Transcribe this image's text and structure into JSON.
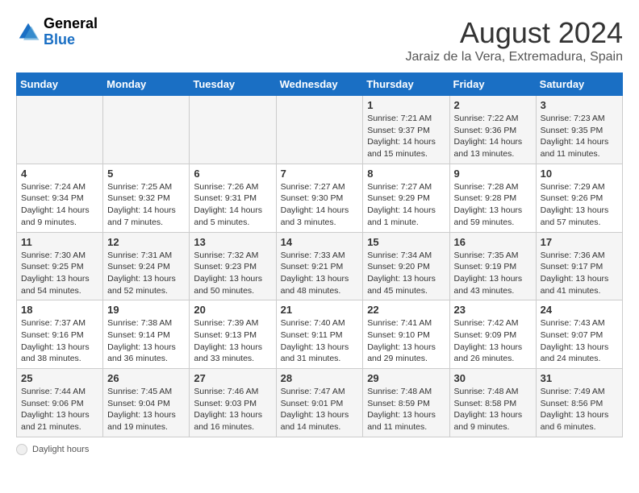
{
  "header": {
    "logo_line1": "General",
    "logo_line2": "Blue",
    "month_title": "August 2024",
    "subtitle": "Jaraiz de la Vera, Extremadura, Spain"
  },
  "weekdays": [
    "Sunday",
    "Monday",
    "Tuesday",
    "Wednesday",
    "Thursday",
    "Friday",
    "Saturday"
  ],
  "weeks": [
    [
      {
        "day": "",
        "info": ""
      },
      {
        "day": "",
        "info": ""
      },
      {
        "day": "",
        "info": ""
      },
      {
        "day": "",
        "info": ""
      },
      {
        "day": "1",
        "info": "Sunrise: 7:21 AM\nSunset: 9:37 PM\nDaylight: 14 hours and 15 minutes."
      },
      {
        "day": "2",
        "info": "Sunrise: 7:22 AM\nSunset: 9:36 PM\nDaylight: 14 hours and 13 minutes."
      },
      {
        "day": "3",
        "info": "Sunrise: 7:23 AM\nSunset: 9:35 PM\nDaylight: 14 hours and 11 minutes."
      }
    ],
    [
      {
        "day": "4",
        "info": "Sunrise: 7:24 AM\nSunset: 9:34 PM\nDaylight: 14 hours and 9 minutes."
      },
      {
        "day": "5",
        "info": "Sunrise: 7:25 AM\nSunset: 9:32 PM\nDaylight: 14 hours and 7 minutes."
      },
      {
        "day": "6",
        "info": "Sunrise: 7:26 AM\nSunset: 9:31 PM\nDaylight: 14 hours and 5 minutes."
      },
      {
        "day": "7",
        "info": "Sunrise: 7:27 AM\nSunset: 9:30 PM\nDaylight: 14 hours and 3 minutes."
      },
      {
        "day": "8",
        "info": "Sunrise: 7:27 AM\nSunset: 9:29 PM\nDaylight: 14 hours and 1 minute."
      },
      {
        "day": "9",
        "info": "Sunrise: 7:28 AM\nSunset: 9:28 PM\nDaylight: 13 hours and 59 minutes."
      },
      {
        "day": "10",
        "info": "Sunrise: 7:29 AM\nSunset: 9:26 PM\nDaylight: 13 hours and 57 minutes."
      }
    ],
    [
      {
        "day": "11",
        "info": "Sunrise: 7:30 AM\nSunset: 9:25 PM\nDaylight: 13 hours and 54 minutes."
      },
      {
        "day": "12",
        "info": "Sunrise: 7:31 AM\nSunset: 9:24 PM\nDaylight: 13 hours and 52 minutes."
      },
      {
        "day": "13",
        "info": "Sunrise: 7:32 AM\nSunset: 9:23 PM\nDaylight: 13 hours and 50 minutes."
      },
      {
        "day": "14",
        "info": "Sunrise: 7:33 AM\nSunset: 9:21 PM\nDaylight: 13 hours and 48 minutes."
      },
      {
        "day": "15",
        "info": "Sunrise: 7:34 AM\nSunset: 9:20 PM\nDaylight: 13 hours and 45 minutes."
      },
      {
        "day": "16",
        "info": "Sunrise: 7:35 AM\nSunset: 9:19 PM\nDaylight: 13 hours and 43 minutes."
      },
      {
        "day": "17",
        "info": "Sunrise: 7:36 AM\nSunset: 9:17 PM\nDaylight: 13 hours and 41 minutes."
      }
    ],
    [
      {
        "day": "18",
        "info": "Sunrise: 7:37 AM\nSunset: 9:16 PM\nDaylight: 13 hours and 38 minutes."
      },
      {
        "day": "19",
        "info": "Sunrise: 7:38 AM\nSunset: 9:14 PM\nDaylight: 13 hours and 36 minutes."
      },
      {
        "day": "20",
        "info": "Sunrise: 7:39 AM\nSunset: 9:13 PM\nDaylight: 13 hours and 33 minutes."
      },
      {
        "day": "21",
        "info": "Sunrise: 7:40 AM\nSunset: 9:11 PM\nDaylight: 13 hours and 31 minutes."
      },
      {
        "day": "22",
        "info": "Sunrise: 7:41 AM\nSunset: 9:10 PM\nDaylight: 13 hours and 29 minutes."
      },
      {
        "day": "23",
        "info": "Sunrise: 7:42 AM\nSunset: 9:09 PM\nDaylight: 13 hours and 26 minutes."
      },
      {
        "day": "24",
        "info": "Sunrise: 7:43 AM\nSunset: 9:07 PM\nDaylight: 13 hours and 24 minutes."
      }
    ],
    [
      {
        "day": "25",
        "info": "Sunrise: 7:44 AM\nSunset: 9:06 PM\nDaylight: 13 hours and 21 minutes."
      },
      {
        "day": "26",
        "info": "Sunrise: 7:45 AM\nSunset: 9:04 PM\nDaylight: 13 hours and 19 minutes."
      },
      {
        "day": "27",
        "info": "Sunrise: 7:46 AM\nSunset: 9:03 PM\nDaylight: 13 hours and 16 minutes."
      },
      {
        "day": "28",
        "info": "Sunrise: 7:47 AM\nSunset: 9:01 PM\nDaylight: 13 hours and 14 minutes."
      },
      {
        "day": "29",
        "info": "Sunrise: 7:48 AM\nSunset: 8:59 PM\nDaylight: 13 hours and 11 minutes."
      },
      {
        "day": "30",
        "info": "Sunrise: 7:48 AM\nSunset: 8:58 PM\nDaylight: 13 hours and 9 minutes."
      },
      {
        "day": "31",
        "info": "Sunrise: 7:49 AM\nSunset: 8:56 PM\nDaylight: 13 hours and 6 minutes."
      }
    ]
  ],
  "legend": {
    "daylight_label": "Daylight hours"
  },
  "colors": {
    "header_bg": "#1a6fc4",
    "odd_row": "#f5f5f5",
    "even_row": "#ffffff"
  }
}
